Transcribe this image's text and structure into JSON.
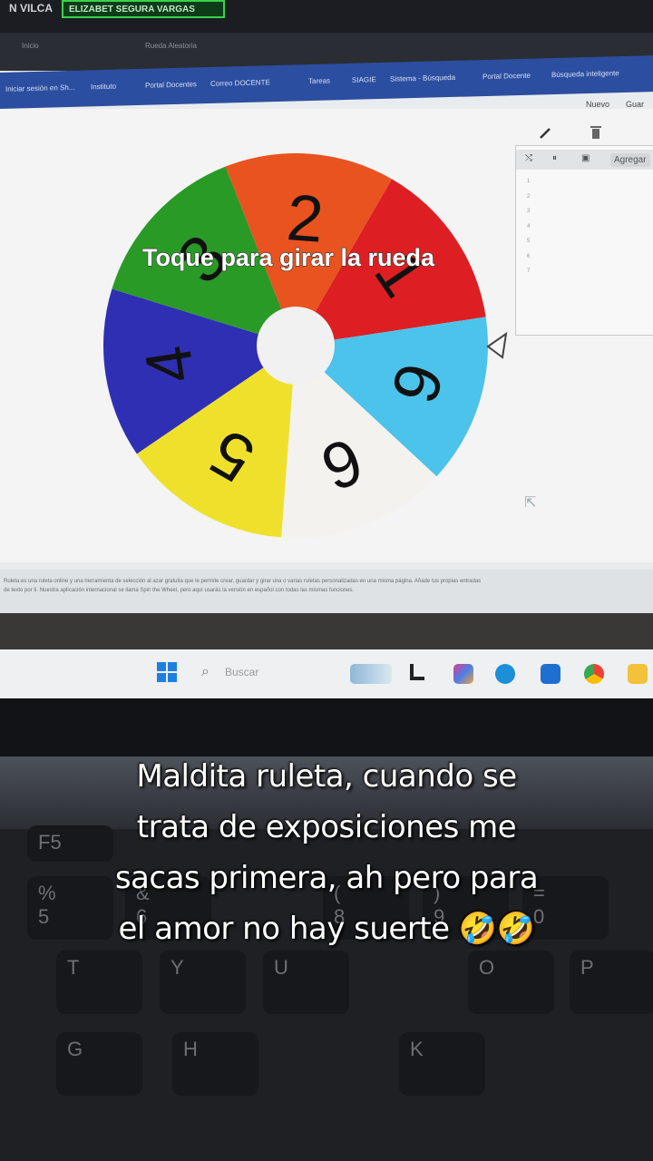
{
  "browser": {
    "prev_tab": "N VILCA",
    "active_tab": "ELIZABET SEGURA VARGAS",
    "tabs": [
      "Inicio",
      "Rueda Aleatoria"
    ],
    "bookmarks": [
      "Iniciar sesión en Sh...",
      "Instituto",
      "Portal Docentes",
      "Correo DOCENTE",
      "Tareas",
      "SIAGIE",
      "Sistema - Búsqueda",
      "Portal Docente",
      "Búsqueda inteligente"
    ]
  },
  "editor": {
    "new_label": "Nuevo",
    "save_label": "Guar",
    "add_label": "Agregar",
    "line_numbers": [
      "1",
      "2",
      "3",
      "4",
      "5",
      "6",
      "7"
    ]
  },
  "wheel": {
    "prompt": "Toque para girar la rueda",
    "segments": [
      {
        "label": "1",
        "color": "#dd1f23"
      },
      {
        "label": "6",
        "color": "#4cc3ea"
      },
      {
        "label": "6",
        "color": "#f4f2ee"
      },
      {
        "label": "5",
        "color": "#efe12b"
      },
      {
        "label": "4",
        "color": "#2f2fb4"
      },
      {
        "label": "3",
        "color": "#2a9a26"
      },
      {
        "label": "2",
        "color": "#e8531f"
      }
    ]
  },
  "description": {
    "line1": "Ruleta.es una ruleta online y una herramienta de selección al azar gratuita que le permite crear, guardar y girar una o varias ruletas personalizadas en una misma página. Añade tus propias entradas",
    "line2": "de texto por ti. Nuestra aplicación internacional se llama Spin the Wheel, pero aquí usarás la versión en español con todas las mismas funciones."
  },
  "taskbar": {
    "search_placeholder": "Buscar"
  },
  "keyboard": {
    "keys": [
      "F5",
      "%\n5",
      "&\n6",
      "(\n8",
      ")\n9",
      "=\n0",
      "T",
      "Y",
      "U",
      "O",
      "P",
      "G",
      "H",
      "K"
    ]
  },
  "caption": {
    "line1": "Maldita ruleta, cuando se",
    "line2": "trata de exposiciones me",
    "line3": "sacas primera, ah pero para",
    "line4": "el amor no hay suerte 🤣🤣"
  }
}
